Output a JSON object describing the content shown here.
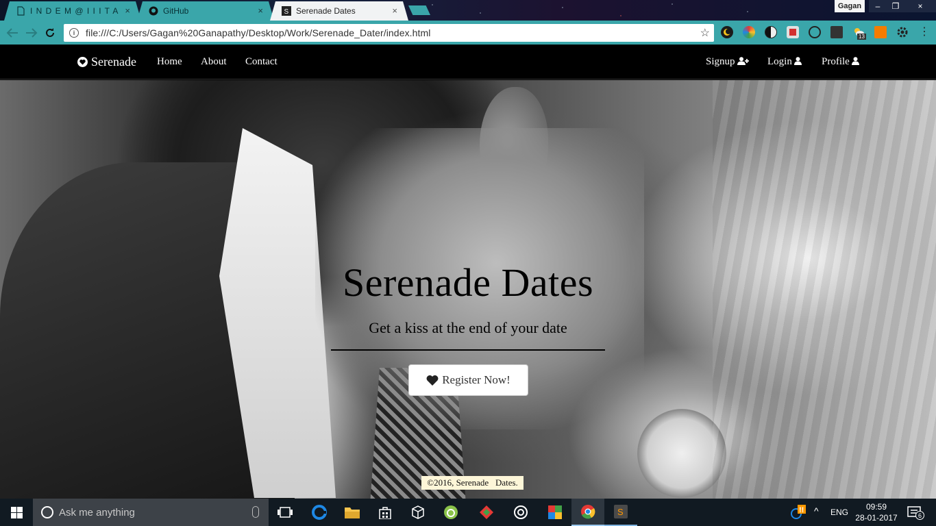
{
  "browser": {
    "tabs": [
      {
        "label": "I N D E M @ I I I T A",
        "active": false
      },
      {
        "label": "GitHub",
        "active": false
      },
      {
        "label": "Serenade Dates",
        "active": true
      }
    ],
    "tab_close_glyph": "×",
    "profile_name": "Gagan",
    "window_controls": {
      "minimize": "–",
      "restore": "❐",
      "close": "×"
    },
    "url": "file:///C:/Users/Gagan%20Ganapathy/Desktop/Work/Serenade_Dater/index.html",
    "info_glyph": "i",
    "extension_badges": {
      "weather_count": "13"
    }
  },
  "site": {
    "brand": "Serenade",
    "nav_left": [
      "Home",
      "About",
      "Contact"
    ],
    "nav_right": [
      "Signup",
      "Login",
      "Profile"
    ],
    "hero": {
      "title": "Serenade Dates",
      "subtitle": "Get a kiss at the end of your date",
      "button_label": "Register Now!"
    },
    "footer": "©2016, Serenade   Dates."
  },
  "taskbar": {
    "search_placeholder": "Ask me anything",
    "language": "ENG",
    "time": "09:59",
    "date": "28-01-2017",
    "notification_count": "6",
    "pinned_apps": [
      "task-view",
      "edge",
      "file-explorer",
      "store",
      "3d-builder",
      "android-studio",
      "gitkraken",
      "groove",
      "office",
      "chrome",
      "sublime-text"
    ]
  },
  "colors": {
    "tab_teal": "#3aa6aa",
    "navbar_bg": "#000000",
    "taskbar_bg": "#111a22"
  }
}
